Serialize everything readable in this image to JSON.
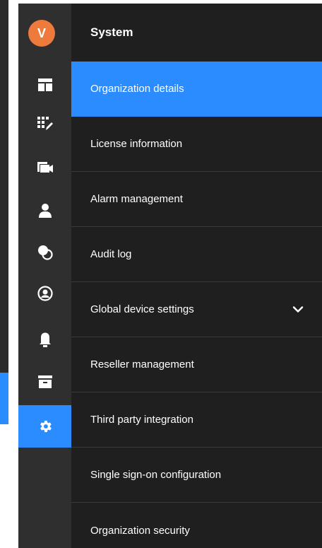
{
  "user": {
    "avatar_initial": "V",
    "avatar_color": "#ee7a3b"
  },
  "colors": {
    "accent": "#2a8cff",
    "rail_bg": "#2f2f2f",
    "menu_bg": "#1f1f1f",
    "divider": "#3a3a3a"
  },
  "rail": {
    "items": [
      {
        "icon": "dashboard-icon",
        "active": false
      },
      {
        "icon": "layout-edit-icon",
        "active": false
      },
      {
        "icon": "camera-icon",
        "active": false
      },
      {
        "icon": "user-icon",
        "active": false
      },
      {
        "icon": "overlap-circles-icon",
        "active": false
      },
      {
        "icon": "account-circle-icon",
        "active": false
      },
      {
        "icon": "bell-icon",
        "active": false
      },
      {
        "icon": "archive-icon",
        "active": false
      },
      {
        "icon": "gear-icon",
        "active": true
      }
    ]
  },
  "menu": {
    "title": "System",
    "items": [
      {
        "label": "Organization details",
        "active": true
      },
      {
        "label": "License information",
        "active": false
      },
      {
        "label": "Alarm management",
        "active": false
      },
      {
        "label": "Audit log",
        "active": false
      },
      {
        "label": "Global device settings",
        "active": false,
        "expandable": true,
        "expand_icon": "chevron-down-icon"
      },
      {
        "label": "Reseller management",
        "active": false
      },
      {
        "label": "Third party integration",
        "active": false
      },
      {
        "label": "Single sign-on configuration",
        "active": false
      },
      {
        "label": "Organization security",
        "active": false
      }
    ]
  }
}
